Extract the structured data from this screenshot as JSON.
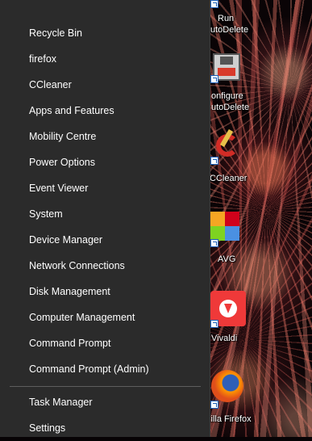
{
  "desktop_icons": [
    {
      "name": "run-autodelete",
      "label_line1": "Run",
      "label_line2": "utoDelete"
    },
    {
      "name": "configure-autodelete",
      "label_line1": "onfigure",
      "label_line2": "utoDelete"
    },
    {
      "name": "ccleaner",
      "label_line1": "CCleaner",
      "label_line2": ""
    },
    {
      "name": "avg",
      "label_line1": "AVG",
      "label_line2": ""
    },
    {
      "name": "vivaldi",
      "label_line1": "Vivaldi",
      "label_line2": ""
    },
    {
      "name": "firefox",
      "label_line1": "zilla Firefox",
      "label_line2": ""
    }
  ],
  "menu": {
    "items": [
      {
        "label": "Recycle Bin"
      },
      {
        "label": "firefox"
      },
      {
        "label": "CCleaner"
      },
      {
        "label": "Apps and Features"
      },
      {
        "label": "Mobility Centre"
      },
      {
        "label": "Power Options"
      },
      {
        "label": "Event Viewer"
      },
      {
        "label": "System"
      },
      {
        "label": "Device Manager"
      },
      {
        "label": "Network Connections"
      },
      {
        "label": "Disk Management"
      },
      {
        "label": "Computer Management"
      },
      {
        "label": "Command Prompt"
      },
      {
        "label": "Command Prompt (Admin)"
      },
      {
        "label": "Task Manager"
      },
      {
        "label": "Settings"
      }
    ]
  },
  "colors": {
    "menu_bg": "#2b2b2b",
    "menu_text": "#ffffff",
    "separator": "#5e5e5e"
  }
}
